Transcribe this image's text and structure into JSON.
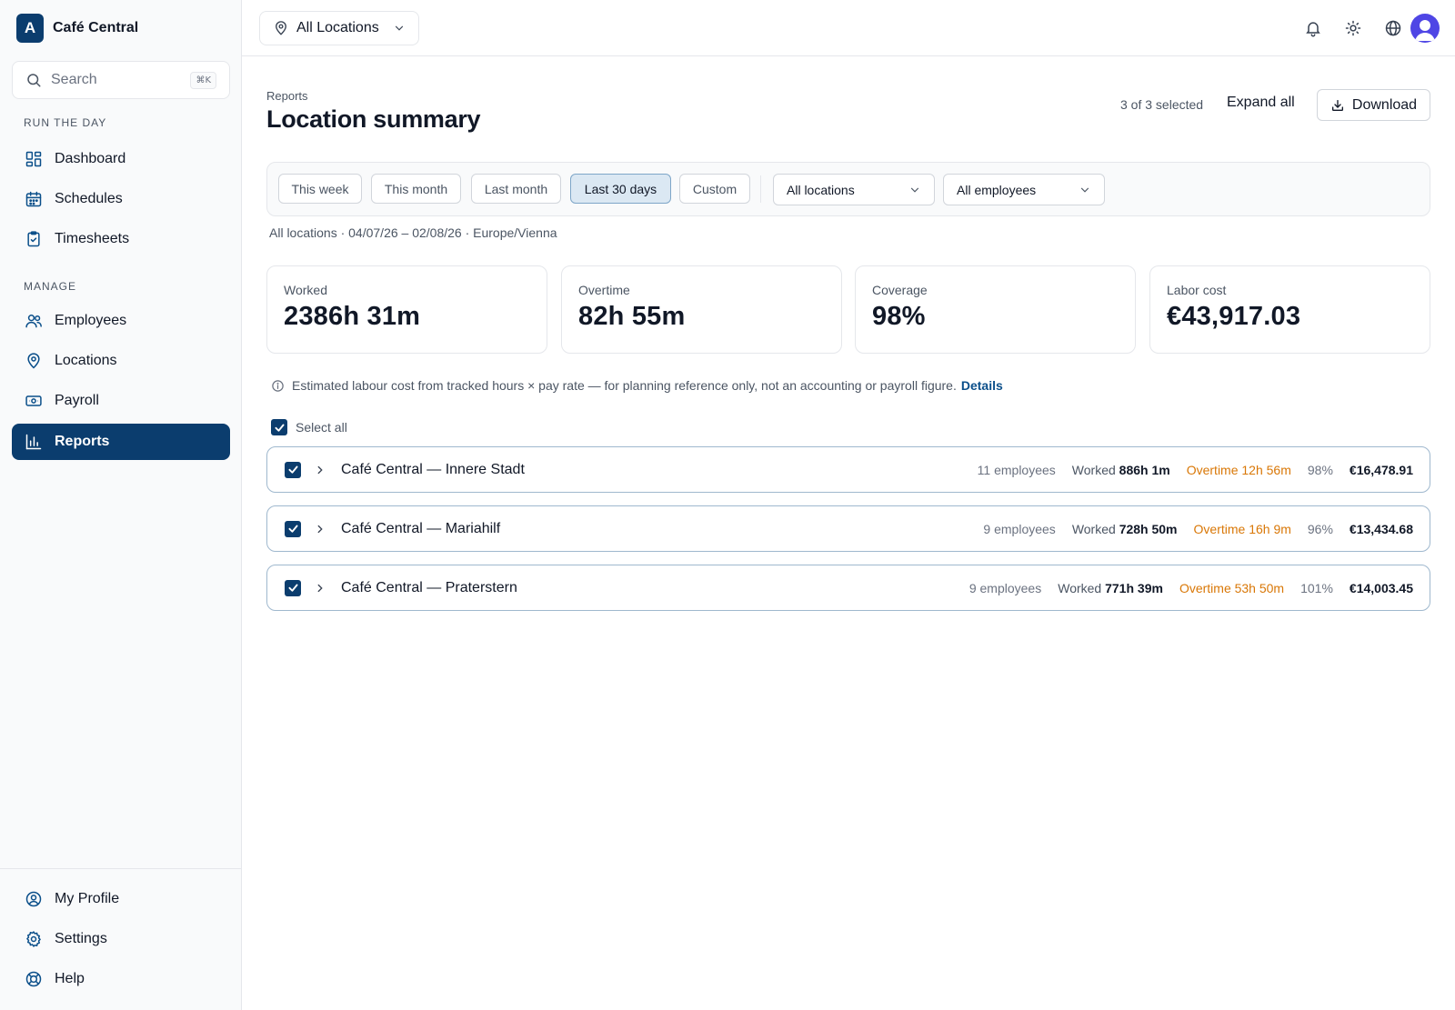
{
  "brand": {
    "logo_letter": "A",
    "name": "Café Central"
  },
  "search": {
    "label": "Search",
    "shortcut": "⌘K"
  },
  "sidebar": {
    "section_run": "RUN THE DAY",
    "section_manage": "MANAGE",
    "items": [
      {
        "label": "Dashboard",
        "icon": "dashboard-icon"
      },
      {
        "label": "Schedules",
        "icon": "calendar-icon"
      },
      {
        "label": "Timesheets",
        "icon": "clipboard-icon"
      },
      {
        "label": "Employees",
        "icon": "users-icon"
      },
      {
        "label": "Locations",
        "icon": "map-pin-icon"
      },
      {
        "label": "Payroll",
        "icon": "banknote-icon"
      },
      {
        "label": "Reports",
        "icon": "bar-chart-icon",
        "active": true
      }
    ],
    "bottom_items": [
      {
        "label": "My Profile",
        "icon": "user-circle-icon"
      },
      {
        "label": "Settings",
        "icon": "gear-icon"
      },
      {
        "label": "Help",
        "icon": "lifebuoy-icon"
      }
    ]
  },
  "topbar": {
    "location_selector": "All Locations",
    "icons": [
      "bell-icon",
      "sun-icon",
      "globe-icon",
      "avatar"
    ]
  },
  "header": {
    "breadcrumb": "Reports",
    "title": "Location summary",
    "selected_count": "3 of 3 selected",
    "expand_all": "Expand all",
    "download": "Download"
  },
  "filters": {
    "ranges": [
      "This week",
      "This month",
      "Last month",
      "Last 30 days",
      "Custom"
    ],
    "active_range": "Last 30 days",
    "locations_dropdown": "All locations",
    "employees_dropdown": "All employees"
  },
  "context_line": "All locations · 04/07/26 – 02/08/26 · Europe/Vienna",
  "stats": [
    {
      "label": "Worked",
      "value": "2386h 31m"
    },
    {
      "label": "Overtime",
      "value": "82h 55m"
    },
    {
      "label": "Coverage",
      "value": "98%"
    },
    {
      "label": "Labor cost",
      "value": "€43,917.03"
    }
  ],
  "note": {
    "text": "Estimated labour cost from tracked hours × pay rate — for planning reference only, not an accounting or payroll figure.",
    "link": "Details"
  },
  "select_all": {
    "label": "Select all",
    "checked": true
  },
  "locations": [
    {
      "name": "Café Central — Innere Stadt",
      "employees": "11 employees",
      "worked_label": "Worked",
      "worked": "886h 1m",
      "overtime": "Overtime 12h 56m",
      "coverage": "98%",
      "cost": "€16,478.91",
      "checked": true
    },
    {
      "name": "Café Central — Mariahilf",
      "employees": "9 employees",
      "worked_label": "Worked",
      "worked": "728h 50m",
      "overtime": "Overtime 16h 9m",
      "coverage": "96%",
      "cost": "€13,434.68",
      "checked": true
    },
    {
      "name": "Café Central — Praterstern",
      "employees": "9 employees",
      "worked_label": "Worked",
      "worked": "771h 39m",
      "overtime": "Overtime 53h 50m",
      "coverage": "101%",
      "cost": "€14,003.45",
      "checked": true
    }
  ],
  "colors": {
    "primary": "#0b3d6e",
    "overtime": "#d97706",
    "active_chip_bg": "#dbe8f3",
    "avatar": "#4f46e5"
  }
}
